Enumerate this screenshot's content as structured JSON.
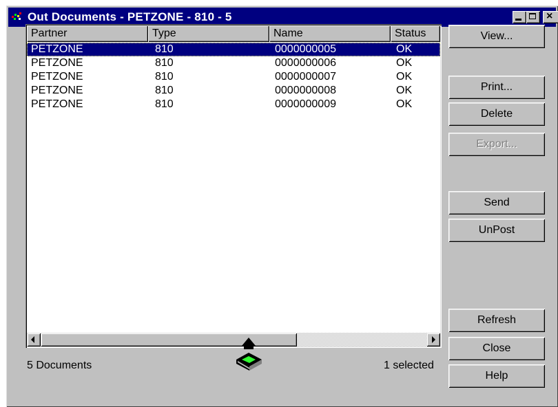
{
  "window": {
    "title": "Out Documents - PETZONE - 810 - 5",
    "app_icon": "edi-app-icon",
    "controls": [
      "minimize",
      "maximize",
      "close"
    ],
    "close_glyph": "×"
  },
  "list": {
    "columns": [
      "Partner",
      "Type",
      "Name",
      "Status"
    ],
    "rows": [
      {
        "partner": "PETZONE",
        "type": "810",
        "name": "0000000005",
        "status": "OK",
        "selected": true
      },
      {
        "partner": "PETZONE",
        "type": "810",
        "name": "0000000006",
        "status": "OK",
        "selected": false
      },
      {
        "partner": "PETZONE",
        "type": "810",
        "name": "0000000007",
        "status": "OK",
        "selected": false
      },
      {
        "partner": "PETZONE",
        "type": "810",
        "name": "0000000008",
        "status": "OK",
        "selected": false
      },
      {
        "partner": "PETZONE",
        "type": "810",
        "name": "0000000009",
        "status": "OK",
        "selected": false
      }
    ]
  },
  "buttons": {
    "view": "View...",
    "print": "Print...",
    "delete": "Delete",
    "export": "Export...",
    "send": "Send",
    "unpost": "UnPost",
    "refresh": "Refresh",
    "close": "Close",
    "help": "Help"
  },
  "status": {
    "count": "5 Documents",
    "selected": "1 selected"
  },
  "colors": {
    "titlebar": "#000080",
    "selection": "#000080",
    "face": "#c0c0c0",
    "tray_green": "#33ff33"
  }
}
